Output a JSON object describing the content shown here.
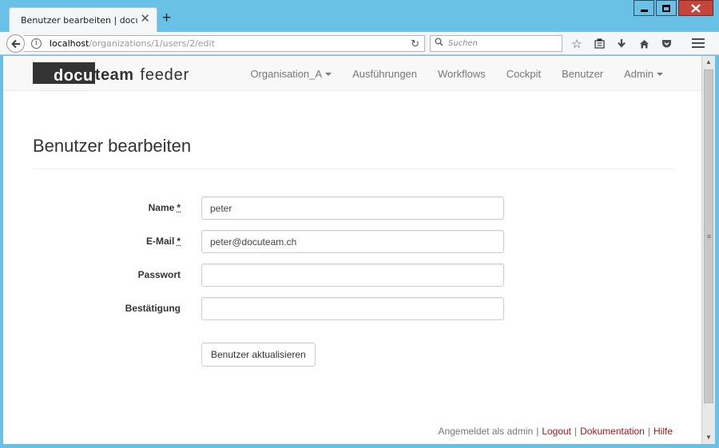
{
  "browser": {
    "tab_title": "Benutzer bearbeiten | docuteam",
    "tab_close_icon": "close-icon",
    "new_tab_icon": "plus-icon",
    "url_host": "localhost",
    "url_path": "/organizations/1/users/2/edit",
    "search_placeholder": "Suchen",
    "toolbar_icons": [
      "star-icon",
      "reading-list-icon",
      "download-icon",
      "home-icon",
      "pocket-icon"
    ],
    "window_controls": [
      "minimize-icon",
      "maximize-icon",
      "close-icon"
    ]
  },
  "app": {
    "logo_docu": "docu",
    "logo_team": "team",
    "logo_feeder": "feeder",
    "nav": {
      "organisation": "Organisation_A",
      "ausfuehrungen": "Ausführungen",
      "workflows": "Workflows",
      "cockpit": "Cockpit",
      "benutzer": "Benutzer",
      "admin": "Admin"
    }
  },
  "page": {
    "title": "Benutzer bearbeiten",
    "form": {
      "name_label": "Name",
      "name_required": "*",
      "name_value": "peter",
      "email_label": "E-Mail",
      "email_required": "*",
      "email_value": "peter@docuteam.ch",
      "password_label": "Passwort",
      "password_value": "",
      "confirm_label": "Bestätigung",
      "confirm_value": "",
      "submit_label": "Benutzer aktualisieren"
    }
  },
  "footer": {
    "logged_in_as": "Angemeldet als admin",
    "logout": "Logout",
    "documentation": "Dokumentation",
    "help": "Hilfe",
    "separator": "|"
  },
  "colors": {
    "window_chrome": "#69c2e5",
    "link_red": "#a8161f",
    "logo_dark": "#333333"
  }
}
